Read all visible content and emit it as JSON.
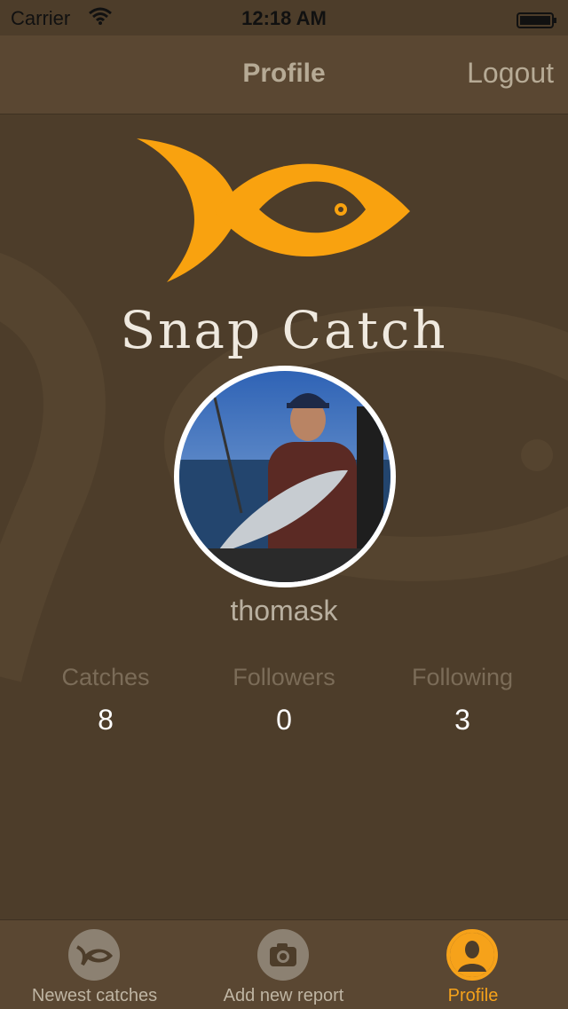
{
  "status_bar": {
    "carrier": "Carrier",
    "time": "12:18 AM",
    "wifi_icon": "wifi-icon",
    "battery_icon": "battery-icon"
  },
  "nav": {
    "title": "Profile",
    "logout_label": "Logout"
  },
  "logo": {
    "text": "Snap Catch",
    "icon": "fish-logo-icon",
    "color": "#f9a20f"
  },
  "profile": {
    "username": "thomask",
    "avatar": "profile-photo"
  },
  "stats": [
    {
      "label": "Catches",
      "value": "8"
    },
    {
      "label": "Followers",
      "value": "0"
    },
    {
      "label": "Following",
      "value": "3"
    }
  ],
  "tabs": [
    {
      "label": "Newest catches",
      "icon": "fish-icon",
      "active": false
    },
    {
      "label": "Add new report",
      "icon": "camera-icon",
      "active": false
    },
    {
      "label": "Profile",
      "icon": "person-icon",
      "active": true
    }
  ],
  "colors": {
    "background": "#4d3d2a",
    "bar": "#5a4732",
    "accent": "#f6a21a"
  }
}
